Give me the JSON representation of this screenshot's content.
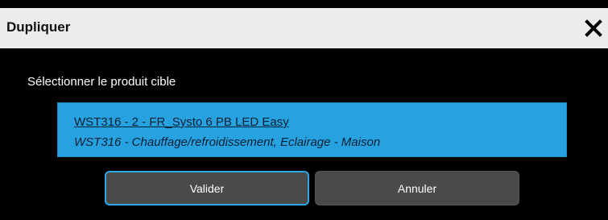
{
  "dialog": {
    "title": "Dupliquer",
    "close_icon": "close-icon",
    "prompt": "Sélectionner le produit cible",
    "product": {
      "name": "WST316 - 2 - FR_Systo 6 PB LED Easy",
      "description": "WST316 - Chauffage/refroidissement, Eclairage - Maison"
    },
    "validate_label": "Valider",
    "cancel_label": "Annuler"
  },
  "colors": {
    "titlebar_bg": "#ececec",
    "body_bg": "#000000",
    "selection_bg": "#27a2e1",
    "button_bg": "#4a4a4a",
    "focus_border": "#2ea7e6"
  }
}
